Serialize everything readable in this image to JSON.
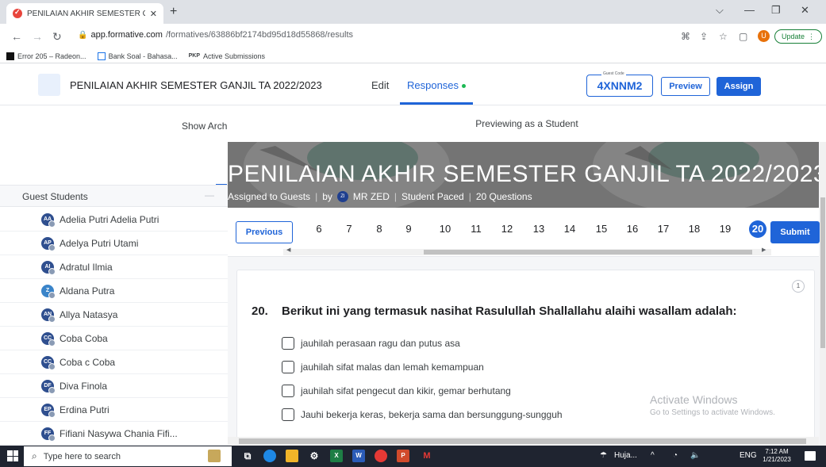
{
  "browser": {
    "tab_title": "PENILAIAN AKHIR SEMESTER GA",
    "tab_close": "✕",
    "new_tab": "+",
    "url_host": "app.formative.com",
    "url_path": "/formatives/63886bf2174bd95d18d55868/results",
    "update_label": "Update",
    "bookmarks": [
      "Error 205 – Radeon...",
      "Bank Soal - Bahasa...",
      "Active Submissions"
    ],
    "bookmark_prefix_3": "PKP"
  },
  "header": {
    "title": "PENILAIAN AKHIR SEMESTER GANJIL TA 2022/2023",
    "edit": "Edit",
    "responses": "Responses",
    "guest_code_label": "Guest Code",
    "guest_code": "4XNNM2",
    "preview": "Preview",
    "assign": "Assign"
  },
  "left": {
    "show_archive": "Show Archiv",
    "guest_students_label": "Guest Students",
    "dash": "—",
    "students": [
      {
        "name": "Adelia Putri Adelia Putri",
        "initials": "AA",
        "color": "#2f4f8f"
      },
      {
        "name": "Adelya Putri Utami",
        "initials": "AP",
        "color": "#2f4f8f"
      },
      {
        "name": "Adratul Ilmia",
        "initials": "AI",
        "color": "#2f4f8f"
      },
      {
        "name": "Aldana Putra",
        "initials": "Z",
        "color": "#3a84c9"
      },
      {
        "name": "Allya Natasya",
        "initials": "AN",
        "color": "#2f4f8f"
      },
      {
        "name": "Coba Coba",
        "initials": "CC",
        "color": "#2f4f8f"
      },
      {
        "name": "Coba c Coba",
        "initials": "CC",
        "color": "#2f4f8f"
      },
      {
        "name": "Diva Finola",
        "initials": "DF",
        "color": "#2f4f8f"
      },
      {
        "name": "Erdina Putri",
        "initials": "EP",
        "color": "#2f4f8f"
      },
      {
        "name": "Fifiani Nasywa Chania Fifi...",
        "initials": "FF",
        "color": "#2f4f8f"
      }
    ]
  },
  "preview": {
    "label": "Previewing as a Student",
    "banner_title": "PENILAIAN AKHIR SEMESTER GANJIL TA 2022/2023",
    "assigned": "Assigned to Guests",
    "by": "by",
    "author_initials": "ZI",
    "author": "MR ZED",
    "pace": "Student Paced",
    "count": "20 Questions",
    "previous": "Previous",
    "submit": "Submit",
    "question_numbers": [
      "6",
      "7",
      "8",
      "9",
      "10",
      "11",
      "12",
      "13",
      "14",
      "15",
      "16",
      "17",
      "18",
      "19",
      "20"
    ],
    "active_question": "20",
    "points": "1",
    "question_number": "20.",
    "question_text": "Berikut ini yang termasuk nasihat Rasulullah Shallallahu alaihi wasallam adalah:",
    "choices": [
      "jauhilah perasaan  ragu dan putus asa",
      "jauhilah sifat malas dan lemah kemampuan",
      "jauhilah sifat pengecut dan kikir, gemar  berhutang",
      "Jauhi bekerja keras, bekerja sama dan bersunggung-sungguh"
    ],
    "watermark_title": "Activate Windows",
    "watermark_sub": "Go to Settings to activate Windows."
  },
  "taskbar": {
    "search_placeholder": "Type here to search",
    "weather": "Huja...",
    "language": "ENG",
    "time": "7:12 AM",
    "date": "1/21/2023"
  }
}
